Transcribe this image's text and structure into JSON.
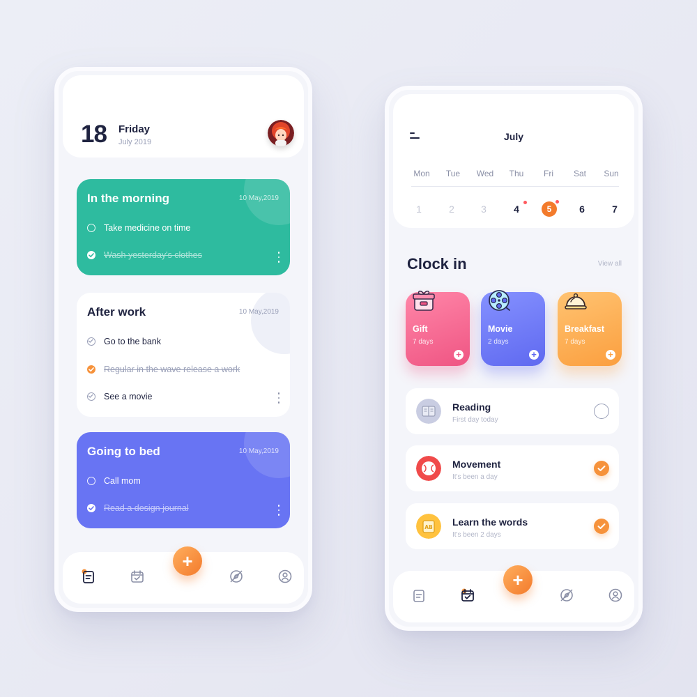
{
  "left_screen": {
    "header": {
      "day_number": "18",
      "day_name": "Friday",
      "month_year": "July 2019"
    },
    "cards": [
      {
        "title": "In the morning",
        "date": "10 May,2019",
        "tasks": [
          {
            "label": "Take medicine on time",
            "done": false
          },
          {
            "label": "Wash yesterday's clothes",
            "done": true
          }
        ]
      },
      {
        "title": "After work",
        "date": "10 May,2019",
        "tasks": [
          {
            "label": "Go to the bank",
            "done": false
          },
          {
            "label": "Regular in the wave release a work",
            "done": true
          },
          {
            "label": "See a movie",
            "done": false
          }
        ]
      },
      {
        "title": "Going to bed",
        "date": "10 May,2019",
        "tasks": [
          {
            "label": "Call mom",
            "done": false
          },
          {
            "label": "Read a design journal",
            "done": true
          }
        ]
      }
    ],
    "nav": {
      "fab_label": "+",
      "active": "tasks"
    }
  },
  "right_screen": {
    "calendar": {
      "month": "July",
      "weekdays": [
        "Mon",
        "Tue",
        "Wed",
        "Thu",
        "Fri",
        "Sat",
        "Sun"
      ],
      "days": [
        "1",
        "2",
        "3",
        "4",
        "5",
        "6",
        "7"
      ],
      "selected_day": "5",
      "days_with_events": [
        "4",
        "5"
      ]
    },
    "clock_in": {
      "title": "Clock in",
      "view_all": "View all",
      "tiles": [
        {
          "name": "Gift",
          "days": "7 days",
          "icon": "gift-icon",
          "plus": "+"
        },
        {
          "name": "Movie",
          "days": "2 days",
          "icon": "film-reel-icon",
          "plus": "+"
        },
        {
          "name": "Breakfast",
          "days": "7 days",
          "icon": "food-cloche-icon",
          "plus": "+"
        }
      ]
    },
    "habits": [
      {
        "name": "Reading",
        "subtitle": "First day today",
        "done": false,
        "icon": "book-icon"
      },
      {
        "name": "Movement",
        "subtitle": "It's been a day",
        "done": true,
        "icon": "ball-icon"
      },
      {
        "name": "Learn the words",
        "subtitle": "It's been 2 days",
        "done": true,
        "icon": "ab-card-icon"
      }
    ],
    "nav": {
      "fab_label": "+",
      "active": "calendar"
    }
  },
  "colors": {
    "orange_accent": "#f37b2c",
    "green_card": "#2ebb9f",
    "purple_card": "#6874f3",
    "gift_pink": "#ef5583",
    "movie_blue": "#5f69f0",
    "breakfast_orange": "#fb9f3f",
    "event_dot_red": "#ff5a5f"
  }
}
